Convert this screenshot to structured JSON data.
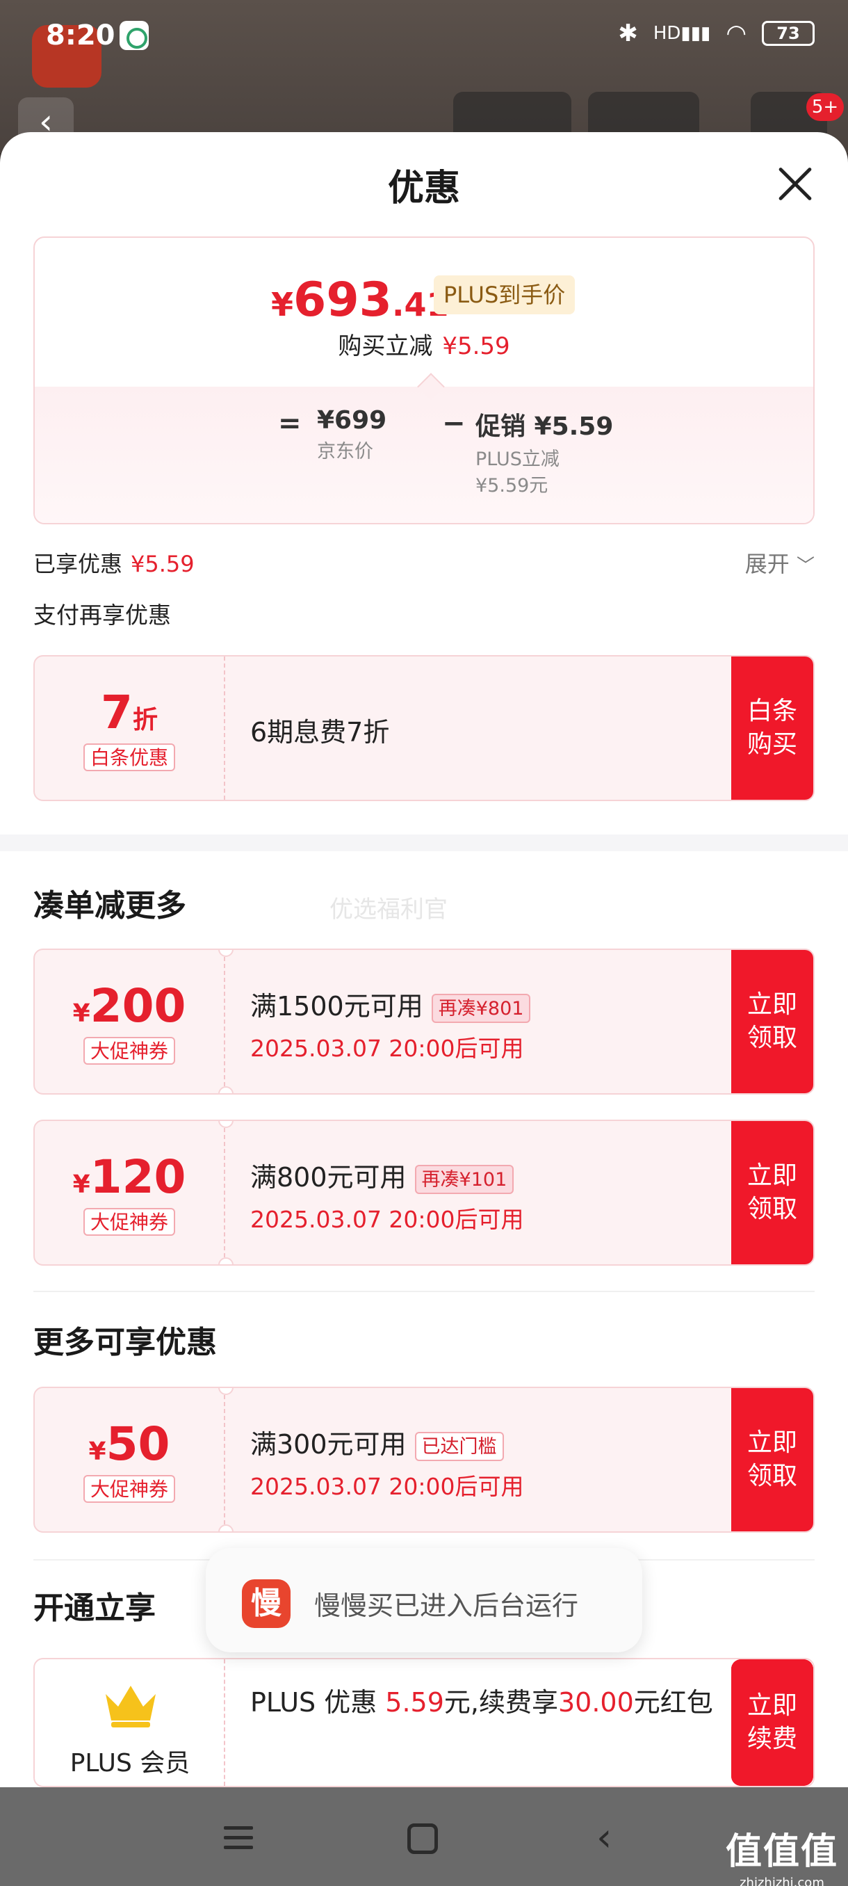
{
  "status_bar": {
    "time": "8:20",
    "battery": "73",
    "hd_label": "HD"
  },
  "background": {
    "cart_badge": "5+"
  },
  "sheet": {
    "title": "优惠"
  },
  "price_card": {
    "currency": "¥",
    "price_int": "693",
    "price_dec": ".41",
    "plus_tag": "PLUS到手价",
    "reduce_label": "购买立减",
    "reduce_value": "¥5.59",
    "equals": "=",
    "jd_price": "¥699",
    "jd_price_label": "京东价",
    "minus": "−",
    "promo_value": "促销 ¥5.59",
    "promo_label_1": "PLUS立减",
    "promo_label_2": "¥5.59元"
  },
  "summary": {
    "enjoyed_label": "已享优惠",
    "enjoyed_value": "¥5.59",
    "expand_label": "展开",
    "pay_more_label": "支付再享优惠"
  },
  "baitiao": {
    "amount": "7",
    "unit": "折",
    "tag": "白条优惠",
    "desc": "6期息费7折",
    "action_line1": "白条",
    "action_line2": "购买"
  },
  "sections": {
    "bundle_title": "凑单减更多",
    "more_title": "更多可享优惠",
    "open_title": "开通立享",
    "watermark": "优选福利官"
  },
  "coupons": [
    {
      "currency": "¥",
      "amount": "200",
      "tag": "大促神券",
      "condition": "满1500元可用",
      "chip": "再凑¥801",
      "when": "2025.03.07 20:00后可用",
      "action_line1": "立即",
      "action_line2": "领取"
    },
    {
      "currency": "¥",
      "amount": "120",
      "tag": "大促神券",
      "condition": "满800元可用",
      "chip": "再凑¥101",
      "when": "2025.03.07 20:00后可用",
      "action_line1": "立即",
      "action_line2": "领取"
    },
    {
      "currency": "¥",
      "amount": "50",
      "tag": "大促神券",
      "condition": "满300元可用",
      "chip": "已达门槛",
      "when": "2025.03.07 20:00后可用",
      "action_line1": "立即",
      "action_line2": "领取"
    }
  ],
  "plus_card": {
    "label": "PLUS 会员",
    "text_a": "PLUS 优惠 ",
    "text_b": "5.59",
    "text_c": "元,续费享",
    "text_d": "30.00",
    "text_e": "元红包",
    "action_line1": "立即",
    "action_line2": "续费"
  },
  "toast": {
    "icon_char": "慢",
    "text": "慢慢买已进入后台运行"
  },
  "corner_watermark": {
    "big": "值值值",
    "small": "zhizhizhi.com"
  },
  "colors": {
    "accent": "#e5202d",
    "action_bg": "#f0182a",
    "coupon_bg": "#fdf2f3",
    "plus_tag_bg": "#fdf0d6"
  }
}
